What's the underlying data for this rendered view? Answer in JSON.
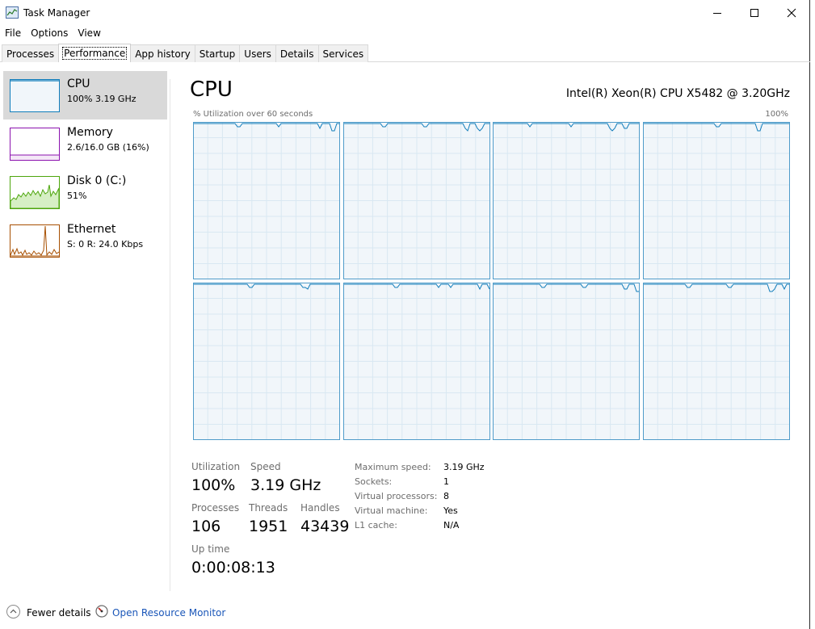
{
  "window": {
    "title": "Task Manager"
  },
  "menu": [
    "File",
    "Options",
    "View"
  ],
  "tabs": [
    "Processes",
    "Performance",
    "App history",
    "Startup",
    "Users",
    "Details",
    "Services"
  ],
  "active_tab": "Performance",
  "resources": [
    {
      "name": "CPU",
      "sub": "100% 3.19 GHz",
      "color": "#117dbb"
    },
    {
      "name": "Memory",
      "sub": "2.6/16.0 GB (16%)",
      "color": "#8b12ae"
    },
    {
      "name": "Disk 0 (C:)",
      "sub": "51%",
      "color": "#4da60c"
    },
    {
      "name": "Ethernet",
      "sub": "S: 0 R: 24.0 Kbps",
      "color": "#a74f01"
    }
  ],
  "main": {
    "title": "CPU",
    "model": "Intel(R) Xeon(R) CPU X5482 @ 3.20GHz",
    "chart_caption": "% Utilization over 60 seconds",
    "chart_max": "100%",
    "core_count": 8
  },
  "stats": {
    "utilization_label": "Utilization",
    "utilization": "100%",
    "speed_label": "Speed",
    "speed": "3.19 GHz",
    "processes_label": "Processes",
    "processes": "106",
    "threads_label": "Threads",
    "threads": "1951",
    "handles_label": "Handles",
    "handles": "43439",
    "uptime_label": "Up time",
    "uptime": "0:00:08:13"
  },
  "specs": {
    "max_speed_label": "Maximum speed:",
    "max_speed": "3.19 GHz",
    "sockets_label": "Sockets:",
    "sockets": "1",
    "vproc_label": "Virtual processors:",
    "vproc": "8",
    "vm_label": "Virtual machine:",
    "vm": "Yes",
    "l1_label": "L1 cache:",
    "l1": "N/A"
  },
  "footer": {
    "fewer_details": "Fewer details",
    "open_resource_monitor": "Open Resource Monitor"
  }
}
